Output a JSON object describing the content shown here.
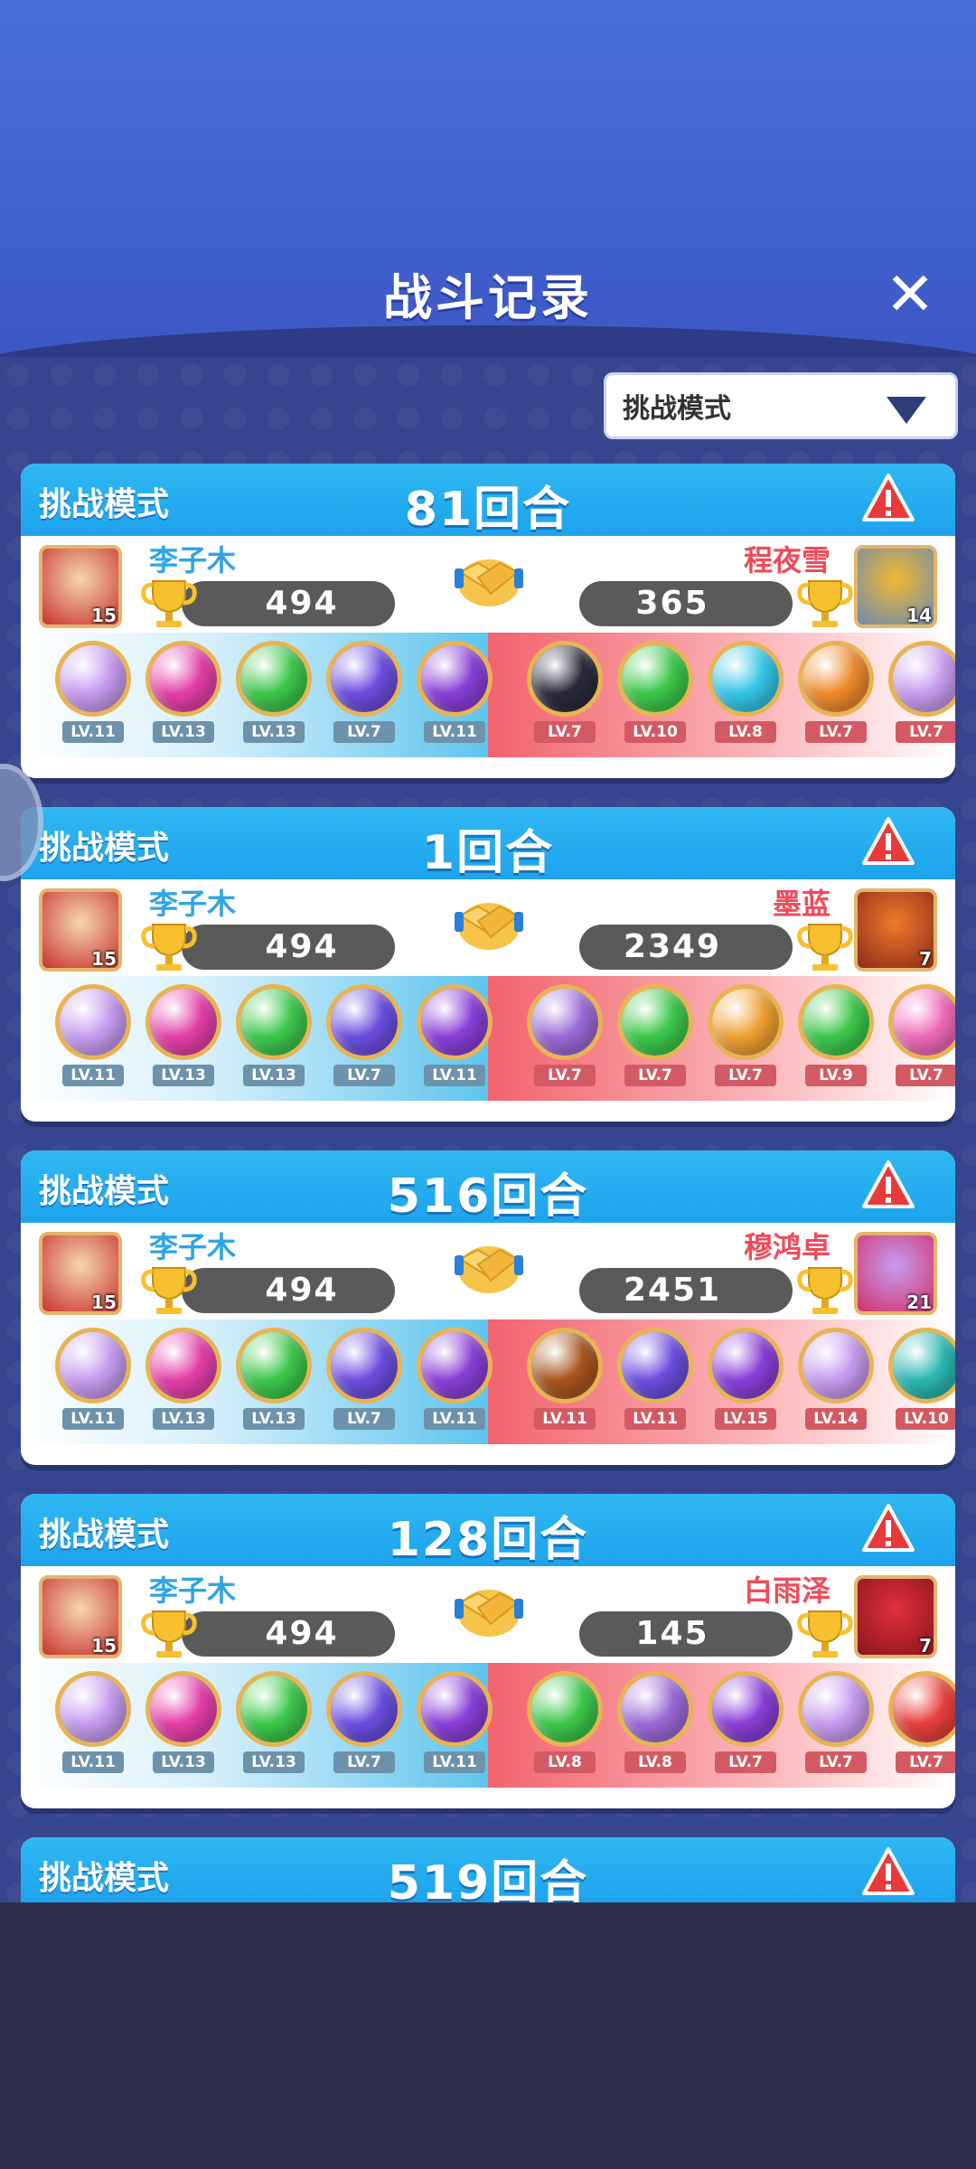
{
  "header": {
    "title": "战斗记录",
    "close_icon": "close-icon"
  },
  "filter": {
    "selected": "挑战模式",
    "icon": "dropdown-triangle-icon"
  },
  "records": [
    {
      "mode": "挑战模式",
      "rounds": "81回合",
      "left": {
        "name": "李子木",
        "score": "494",
        "avatar_level": "15",
        "avatar_colors": [
          "#f4d6b0",
          "#c9322e"
        ],
        "orbs": [
          {
            "level": "LV.11",
            "color": "#c79cf0"
          },
          {
            "level": "LV.13",
            "color": "#e53fa8"
          },
          {
            "level": "LV.13",
            "color": "#3cc84a"
          },
          {
            "level": "LV.7",
            "color": "#6b4ee0"
          },
          {
            "level": "LV.11",
            "color": "#8a3fd8"
          }
        ]
      },
      "right": {
        "name": "程夜雪",
        "score": "365",
        "avatar_level": "14",
        "avatar_colors": [
          "#f0b832",
          "#6d8bb0"
        ],
        "orbs": [
          {
            "level": "LV.7",
            "color": "#2a2a3a"
          },
          {
            "level": "LV.10",
            "color": "#3cc84a"
          },
          {
            "level": "LV.8",
            "color": "#33c6e8"
          },
          {
            "level": "LV.7",
            "color": "#f08a2c"
          },
          {
            "level": "LV.7",
            "color": "#c79cf0"
          }
        ]
      }
    },
    {
      "mode": "挑战模式",
      "rounds": "1回合",
      "left": {
        "name": "李子木",
        "score": "494",
        "avatar_level": "15",
        "avatar_colors": [
          "#f4d6b0",
          "#c9322e"
        ],
        "orbs": [
          {
            "level": "LV.11",
            "color": "#c79cf0"
          },
          {
            "level": "LV.13",
            "color": "#e53fa8"
          },
          {
            "level": "LV.13",
            "color": "#3cc84a"
          },
          {
            "level": "LV.7",
            "color": "#6b4ee0"
          },
          {
            "level": "LV.11",
            "color": "#8a3fd8"
          }
        ]
      },
      "right": {
        "name": "墨蓝",
        "score": "2349",
        "avatar_level": "7",
        "avatar_colors": [
          "#f07a2a",
          "#8c2a1a"
        ],
        "orbs": [
          {
            "level": "LV.7",
            "color": "#9b6ad8"
          },
          {
            "level": "LV.7",
            "color": "#3cc84a"
          },
          {
            "level": "LV.7",
            "color": "#f0a030"
          },
          {
            "level": "LV.9",
            "color": "#3cc84a"
          },
          {
            "level": "LV.7",
            "color": "#f06ab8"
          }
        ]
      }
    },
    {
      "mode": "挑战模式",
      "rounds": "516回合",
      "left": {
        "name": "李子木",
        "score": "494",
        "avatar_level": "15",
        "avatar_colors": [
          "#f4d6b0",
          "#c9322e"
        ],
        "orbs": [
          {
            "level": "LV.11",
            "color": "#c79cf0"
          },
          {
            "level": "LV.13",
            "color": "#e53fa8"
          },
          {
            "level": "LV.13",
            "color": "#3cc84a"
          },
          {
            "level": "LV.7",
            "color": "#6b4ee0"
          },
          {
            "level": "LV.11",
            "color": "#8a3fd8"
          }
        ]
      },
      "right": {
        "name": "穆鸿卓",
        "score": "2451",
        "avatar_level": "21",
        "avatar_colors": [
          "#c79cf0",
          "#d0326a"
        ],
        "orbs": [
          {
            "level": "LV.11",
            "color": "#a8561e"
          },
          {
            "level": "LV.11",
            "color": "#6b4ee0"
          },
          {
            "level": "LV.15",
            "color": "#8a3fd8"
          },
          {
            "level": "LV.14",
            "color": "#c79cf0"
          },
          {
            "level": "LV.10",
            "color": "#2ab8b0"
          }
        ]
      }
    },
    {
      "mode": "挑战模式",
      "rounds": "128回合",
      "left": {
        "name": "李子木",
        "score": "494",
        "avatar_level": "15",
        "avatar_colors": [
          "#f4d6b0",
          "#c9322e"
        ],
        "orbs": [
          {
            "level": "LV.11",
            "color": "#c79cf0"
          },
          {
            "level": "LV.13",
            "color": "#e53fa8"
          },
          {
            "level": "LV.13",
            "color": "#3cc84a"
          },
          {
            "level": "LV.7",
            "color": "#6b4ee0"
          },
          {
            "level": "LV.11",
            "color": "#8a3fd8"
          }
        ]
      },
      "right": {
        "name": "白雨泽",
        "score": "145",
        "avatar_level": "7",
        "avatar_colors": [
          "#e0303a",
          "#8a1420"
        ],
        "orbs": [
          {
            "level": "LV.8",
            "color": "#3cc84a"
          },
          {
            "level": "LV.8",
            "color": "#9b6ad8"
          },
          {
            "level": "LV.7",
            "color": "#8a3fd8"
          },
          {
            "level": "LV.7",
            "color": "#c79cf0"
          },
          {
            "level": "LV.7",
            "color": "#e8403c"
          }
        ]
      }
    }
  ],
  "partial_record": {
    "mode": "挑战模式",
    "rounds": "519回合"
  },
  "colors": {
    "header_blue": "#1ea3ec",
    "left_name": "#2ea4e6",
    "right_name": "#ef4b5a",
    "gold": "#e8b453"
  }
}
